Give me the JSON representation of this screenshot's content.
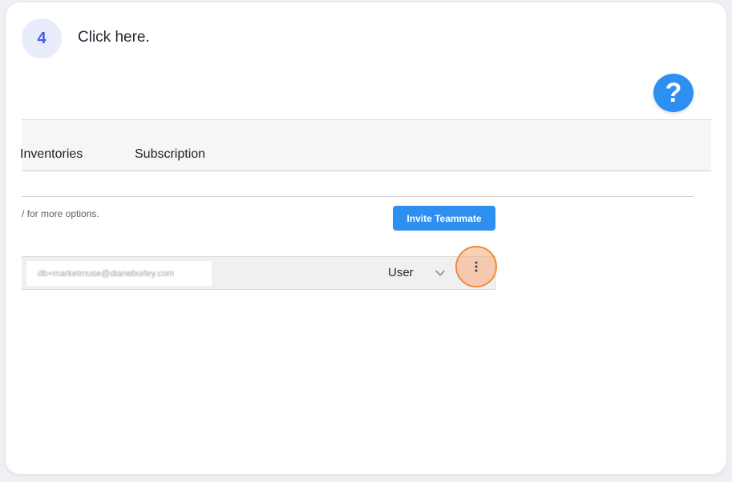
{
  "step": {
    "number": "4",
    "instruction": "Click here."
  },
  "help": {
    "label": "?"
  },
  "tabs": [
    {
      "label": "Inventories"
    },
    {
      "label": "Subscription"
    }
  ],
  "team": {
    "hint": "/ for more options.",
    "invite_label": "Invite Teammate",
    "members": [
      {
        "email": "db+marketmuse@dianeburley.com",
        "role": "User"
      }
    ]
  },
  "colors": {
    "accent": "#2d8ff0",
    "step_badge_bg": "#e8ecfb",
    "step_badge_text": "#4a5de0",
    "highlight_ring": "#f08a3c"
  },
  "icons": {
    "help": "question-mark-icon",
    "role_dropdown": "chevron-down-icon",
    "row_menu": "more-vertical-icon"
  }
}
